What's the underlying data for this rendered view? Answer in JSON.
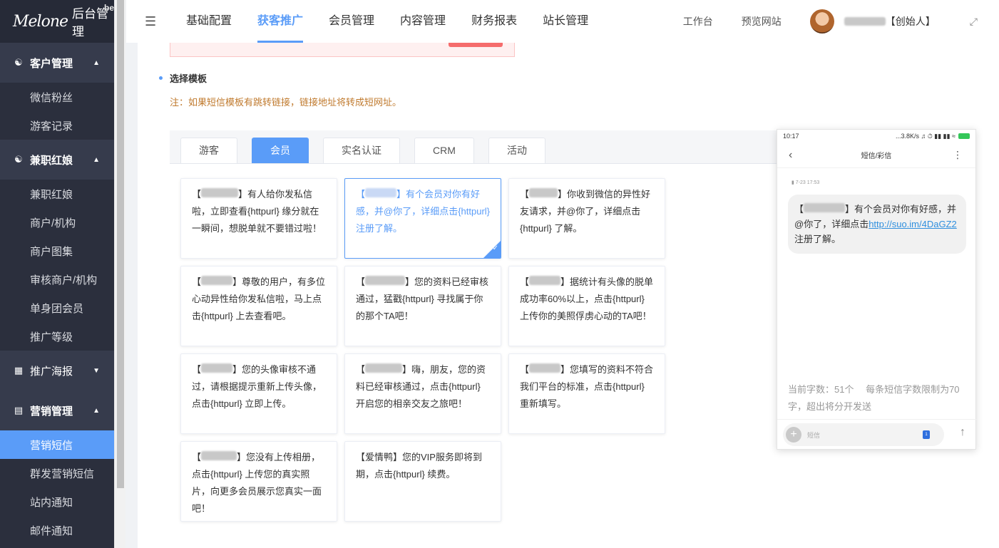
{
  "sidebar": {
    "logo_mark": "Melone",
    "logo_text": "后台管理",
    "logo_badge": "be",
    "groups": [
      {
        "label": "客户管理",
        "items": [
          "微信粉丝",
          "游客记录"
        ]
      },
      {
        "label": "兼职红娘",
        "items": [
          "兼职红娘",
          "商户/机构",
          "商户图集",
          "审核商户/机构",
          "单身团会员",
          "推广等级"
        ]
      },
      {
        "label": "推广海报",
        "items": []
      },
      {
        "label": "营销管理",
        "items": [
          "营销短信",
          "群发营销短信",
          "站内通知",
          "邮件通知"
        ]
      }
    ]
  },
  "header": {
    "tabs": [
      "基础配置",
      "获客推广",
      "会员管理",
      "内容管理",
      "财务报表",
      "站长管理"
    ],
    "active_tab": "获客推广",
    "workbench": "工作台",
    "preview": "预览网站",
    "user_role": "【创始人】"
  },
  "content": {
    "section_title": "选择模板",
    "note": "注：如果短信模板有跳转链接，链接地址将转成短网址。",
    "tabs": [
      "游客",
      "会员",
      "实名认证",
      "CRM",
      "活动"
    ],
    "active_tab": "会员",
    "cards": [
      "】有人给你发私信啦，立即查看{httpurl} 缘分就在一瞬间，想脱单就不要错过啦！",
      "】有个会员对你有好感，并@你了，详细点击{httpurl} 注册了解。",
      "】你收到微信的异性好友请求，并@你了，详细点击{httpurl} 了解。",
      "】尊敬的用户，有多位心动异性给你发私信啦，马上点击{httpurl} 上去查看吧。",
      "】您的资料已经审核通过，猛戳{httpurl} 寻找属于你的那个TA吧！",
      "】据统计有头像的脱单成功率60%以上，点击{httpurl} 上传你的美照俘虏心动的TA吧！",
      "】您的头像审核不通过，请根据提示重新上传头像，点击{httpurl} 立即上传。",
      "】嗨，朋友，您的资料已经审核通过，点击{httpurl} 开启您的相亲交友之旅吧！",
      "】您填写的资料不符合我们平台的标准，点击{httpurl} 重新填写。",
      "】您没有上传相册，点击{httpurl} 上传您的真实照片，向更多会员展示您真实一面吧！",
      "【爱情鸭】您的VIP服务即将到期，点击{httpurl} 续费。"
    ]
  },
  "phone": {
    "time": "10:17",
    "status_right": "...3.8K/s",
    "title": "短信/彩信",
    "msg_time": "7-23 17:53",
    "msg_prefix": "】有个会员对你有好感，并@你了，详细点击",
    "msg_link": "http://suo.im/4DaGZ2",
    "msg_suffix": " 注册了解。",
    "counter": "当前字数：51个　 每条短信字数限制为70字，超出将分开发送",
    "input_placeholder": "短信"
  }
}
